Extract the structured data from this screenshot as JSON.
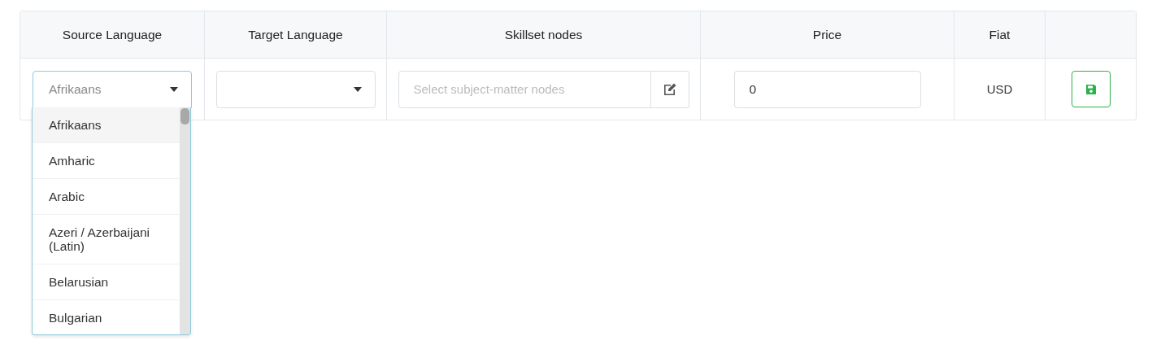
{
  "table": {
    "columns": [
      "Source Language",
      "Target Language",
      "Skillset nodes",
      "Price",
      "Fiat",
      ""
    ],
    "row": {
      "source_language": {
        "placeholder": "Afrikaans",
        "expanded": true
      },
      "target_language": {
        "expanded": false
      },
      "skillset_nodes": {
        "placeholder": "Select subject-matter nodes"
      },
      "price": {
        "value": "0"
      },
      "fiat": "USD"
    }
  },
  "dropdown": {
    "options": [
      {
        "label": "Afrikaans",
        "selected": true
      },
      {
        "label": "Amharic",
        "selected": false
      },
      {
        "label": "Arabic",
        "selected": false
      },
      {
        "label": "Azeri / Azerbaijani (Latin)",
        "selected": false
      },
      {
        "label": "Belarusian",
        "selected": false
      },
      {
        "label": "Bulgarian",
        "selected": false
      }
    ]
  }
}
